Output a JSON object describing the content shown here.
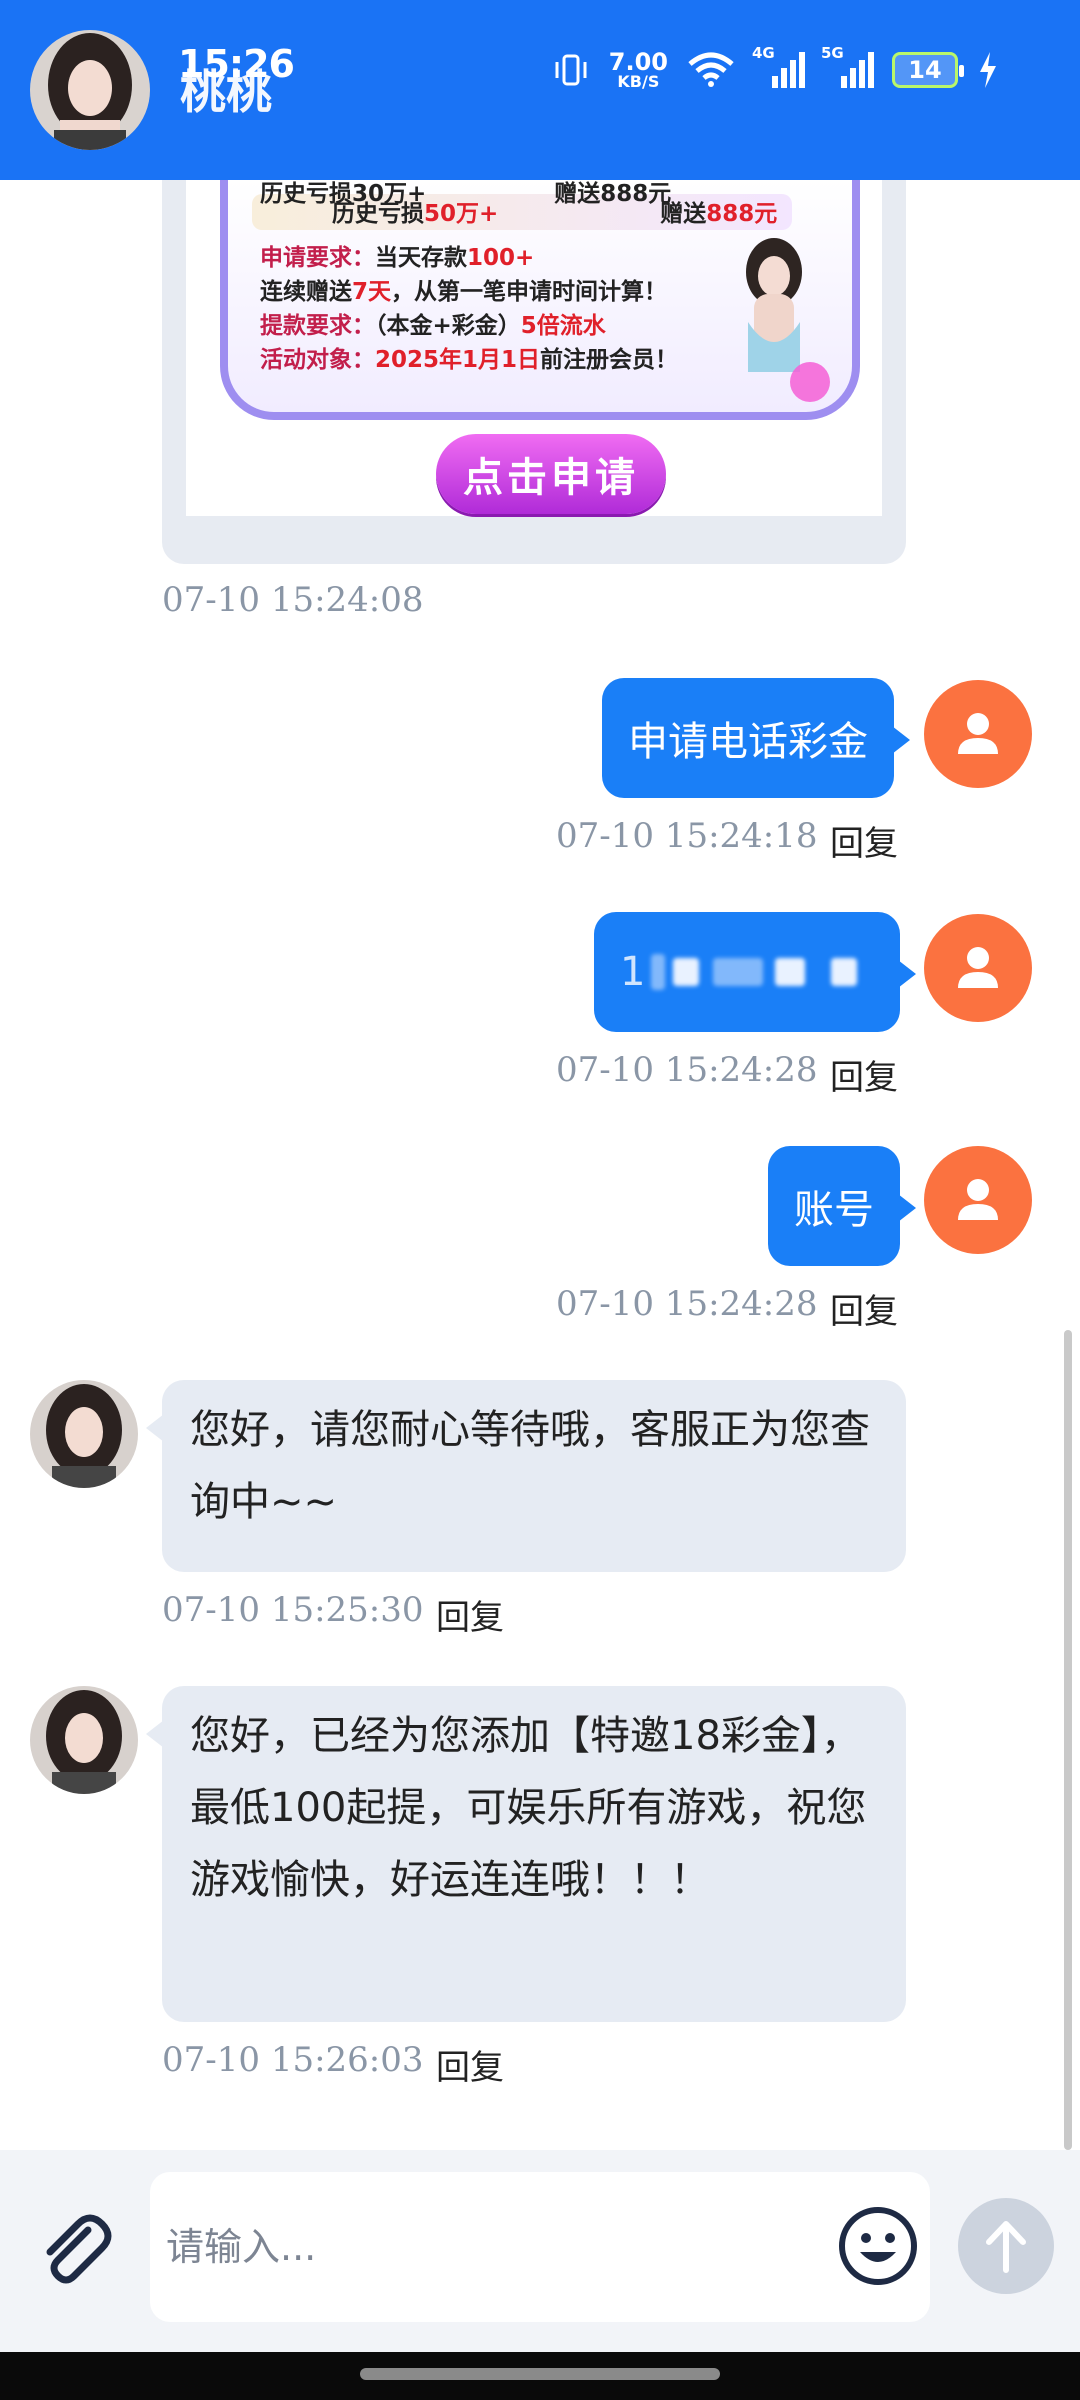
{
  "header": {
    "time": "15:26",
    "contact_name": "桃桃",
    "net_speed_value": "7.00",
    "net_speed_unit": "KB/S",
    "signal_1": "4G",
    "signal_2": "5G",
    "battery": "14"
  },
  "promo": {
    "row0_left": "历史亏损30万+",
    "row0_right": "赠送888元",
    "row1_left": "历史亏损",
    "row1_left_hl": "50万+",
    "row1_right": "赠送",
    "row1_right_hl": "888元",
    "row2_label": "申请要求：",
    "row2_text": "当天存款",
    "row2_hl": "100+",
    "row3_text": "连续赠送",
    "row3_hl": "7天",
    "row3_rest": "，从第一笔申请时间计算！",
    "row4_label": "提款要求：",
    "row4_text": "（本金+彩金）",
    "row4_hl": "5倍流水",
    "row5_label": "活动对象：",
    "row5_hl": "2025年1月1日",
    "row5_rest": "前注册会员！",
    "button_label": "点击申请",
    "timestamp": "07-10 15:24:08"
  },
  "messages": [
    {
      "side": "me",
      "text": "申请电话彩金",
      "timestamp": "07-10 15:24:18",
      "reply": "回复"
    },
    {
      "side": "me",
      "text": "1",
      "timestamp": "07-10 15:24:28",
      "reply": "回复"
    },
    {
      "side": "me",
      "text": "账号",
      "timestamp": "07-10 15:24:28",
      "reply": "回复"
    },
    {
      "side": "them",
      "text": "您好，请您耐心等待哦，客服正为您查询中~~",
      "timestamp": "07-10 15:25:30",
      "reply": "回复"
    },
    {
      "side": "them",
      "text": "您好，已经为您添加【特邀18彩金】，最低100起提，可娱乐所有游戏，祝您游戏愉快，好运连连哦！！！",
      "timestamp": "07-10 15:26:03",
      "reply": "回复"
    }
  ],
  "input": {
    "placeholder": "请输入..."
  },
  "colors": {
    "header": "#1a73f5",
    "my_bubble": "#1a7ff7",
    "their_bubble": "#e6ebf3",
    "user_avatar": "#fb7240"
  },
  "icons": [
    "vibrate-icon",
    "wifi-icon",
    "signal-icon",
    "battery-icon",
    "charging-icon",
    "user-icon",
    "attach-icon",
    "emoji-icon",
    "send-arrow-icon"
  ]
}
